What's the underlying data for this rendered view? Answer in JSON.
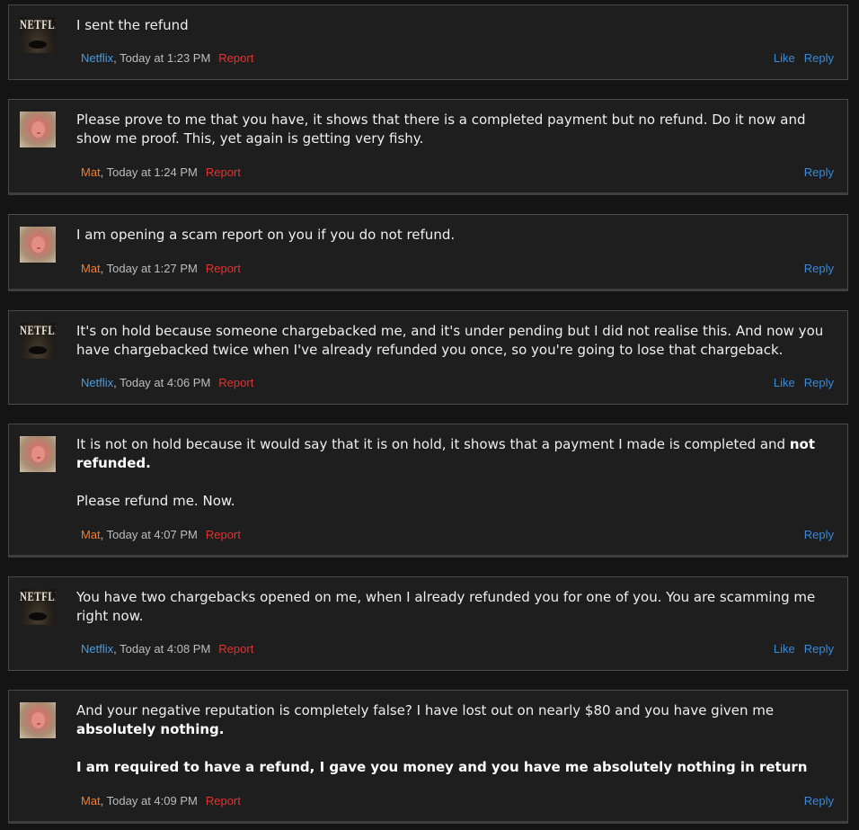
{
  "posts": [
    {
      "author": "Netflix",
      "time": ", Today at 1:23 PM",
      "report": "Report",
      "like": "Like",
      "reply": "Reply",
      "paragraphs": [
        [
          {
            "t": "I sent the refund"
          }
        ]
      ]
    },
    {
      "author": "Mat",
      "time": ", Today at 1:24 PM",
      "report": "Report",
      "reply": "Reply",
      "paragraphs": [
        [
          {
            "t": "Please prove to me that you have, it shows that there is a completed payment but no refund. Do it now and show me proof. This, yet again is getting very fishy."
          }
        ]
      ]
    },
    {
      "author": "Mat",
      "time": ", Today at 1:27 PM",
      "report": "Report",
      "reply": "Reply",
      "paragraphs": [
        [
          {
            "t": "I am opening a scam report on you if you do not refund."
          }
        ]
      ]
    },
    {
      "author": "Netflix",
      "time": ", Today at 4:06 PM",
      "report": "Report",
      "like": "Like",
      "reply": "Reply",
      "paragraphs": [
        [
          {
            "t": "It's on hold because someone chargebacked me, and it's under pending but I did not realise this. And now you have chargebacked twice when I've already refunded you once, so you're going to lose that chargeback."
          }
        ]
      ]
    },
    {
      "author": "Mat",
      "time": ", Today at 4:07 PM",
      "report": "Report",
      "reply": "Reply",
      "paragraphs": [
        [
          {
            "t": "It is not on hold because it would say that it is on hold, it shows that a payment I made is completed and "
          },
          {
            "t": "not refunded.",
            "b": true
          }
        ],
        [
          {
            "t": "Please refund me. Now."
          }
        ]
      ]
    },
    {
      "author": "Netflix",
      "time": ", Today at 4:08 PM",
      "report": "Report",
      "like": "Like",
      "reply": "Reply",
      "paragraphs": [
        [
          {
            "t": "You have two chargebacks opened on me, when I already refunded you for one of you. You are scamming me right now."
          }
        ]
      ]
    },
    {
      "author": "Mat",
      "time": ", Today at 4:09 PM",
      "report": "Report",
      "reply": "Reply",
      "paragraphs": [
        [
          {
            "t": "And your negative reputation is completely false? I have lost out on nearly $80 and you have given me "
          },
          {
            "t": "absolutely nothing.",
            "b": true
          }
        ],
        [
          {
            "t": "I am required to have a refund, I gave you money and you have me absolutely nothing in return",
            "b": true
          }
        ]
      ]
    }
  ],
  "avatars": {
    "netflix_logo_text": "NETFLIX",
    "netflix_icon": "netflix-avatar-icon",
    "mat_icon": "mat-avatar-photo"
  },
  "colors": {
    "background": "#141414",
    "post_background": "#1e1e1e",
    "netflix_username": "#4a9be0",
    "mat_username": "#f07c2e",
    "report": "#e53232",
    "action_link": "#3a8ad8"
  }
}
